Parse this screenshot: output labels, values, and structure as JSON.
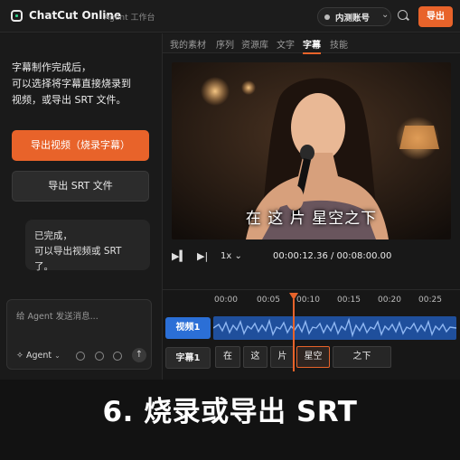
{
  "header": {
    "app_title": "ChatCut Online",
    "app_subtitle": "Agent 工作台",
    "account_label": "内测账号",
    "export_label": "导出",
    "accent": "#e8632a"
  },
  "tabs": [
    "我的素材",
    "序列",
    "资源库",
    "文字",
    "字幕",
    "技能"
  ],
  "active_tab": "字幕",
  "chat": {
    "intro": "字幕制作完成后，\n可以选择将字幕直接烧录到\n视频，或导出 SRT 文件。",
    "export_video_label": "导出视频（烧录字幕）",
    "export_srt_label": "导出 SRT 文件",
    "done_message": "已完成，\n可以导出视频或 SRT 了。",
    "composer_placeholder": "给 Agent 发送消息...",
    "agent_selector": "Agent"
  },
  "player": {
    "subtitle": "在 这 片 星空之下",
    "speed": "1x",
    "timecode": "00:00:12.36 / 00:08:00.00"
  },
  "timeline": {
    "ruler": [
      "00:00",
      "00:05",
      "00:10",
      "00:15",
      "00:20",
      "00:25"
    ],
    "video_track_label": "视频1",
    "subtitle_track_label": "字幕1",
    "subtitle_clips": [
      "在",
      "这",
      "片",
      "星空",
      "之下"
    ],
    "active_clip": "星空"
  },
  "caption": "6. 烧录或导出 SRT"
}
